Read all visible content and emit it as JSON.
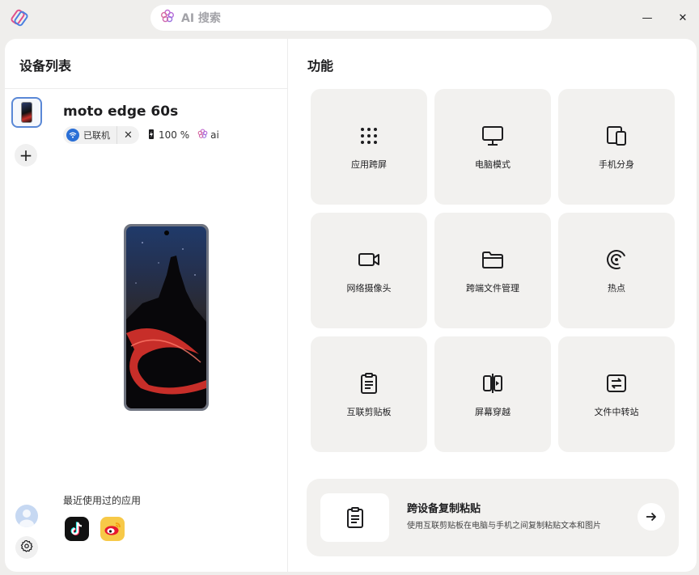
{
  "titlebar": {
    "search_placeholder": "AI 搜索",
    "minimize_symbol": "—",
    "close_symbol": "✕"
  },
  "left_panel": {
    "title": "设备列表",
    "add_symbol": "+",
    "device": {
      "name": "moto edge 60s",
      "connection_status": "已联机",
      "disconnect_symbol": "✕",
      "battery": "100 %",
      "ai_label": "ai"
    },
    "recent_apps": {
      "title": "最近使用过的应用",
      "apps": [
        "tiktok-app",
        "weibo-app"
      ]
    }
  },
  "right_panel": {
    "title": "功能",
    "features": [
      {
        "label": "应用跨屏",
        "icon": "grid-dots-icon"
      },
      {
        "label": "电脑模式",
        "icon": "monitor-icon"
      },
      {
        "label": "手机分身",
        "icon": "phone-mirror-icon"
      },
      {
        "label": "网络摄像头",
        "icon": "video-camera-icon"
      },
      {
        "label": "跨端文件管理",
        "icon": "folder-icon"
      },
      {
        "label": "热点",
        "icon": "hotspot-icon"
      },
      {
        "label": "互联剪贴板",
        "icon": "clipboard-icon"
      },
      {
        "label": "屏幕穿越",
        "icon": "screen-swap-icon"
      },
      {
        "label": "文件中转站",
        "icon": "transfer-icon"
      }
    ],
    "clipboard_card": {
      "title": "跨设备复制粘贴",
      "description": "使用互联剪贴板在电脑与手机之间复制粘贴文本和图片"
    }
  },
  "colors": {
    "accent_blue": "#2a6fd6",
    "tile_bg": "#f2f1ef",
    "window_bg": "#efeeec"
  }
}
